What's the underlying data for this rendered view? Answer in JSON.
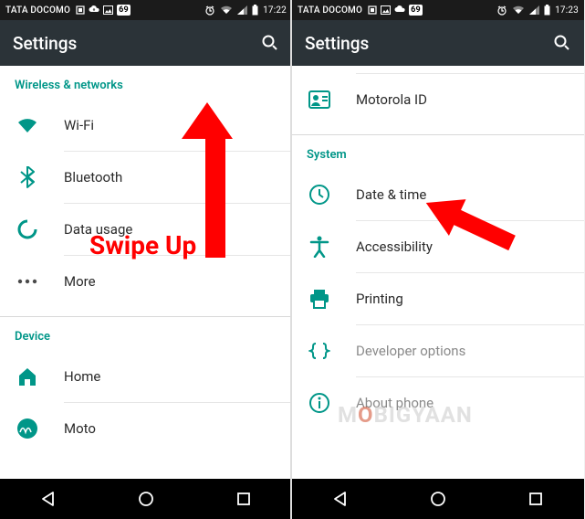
{
  "status": {
    "carrier": "TATA DOCOMO",
    "battery_badge": "69",
    "time_left": "17:22",
    "time_right": "17:23"
  },
  "appbar": {
    "title": "Settings"
  },
  "left": {
    "section1_header": "Wireless & networks",
    "items1": [
      {
        "label": "Wi-Fi"
      },
      {
        "label": "Bluetooth"
      },
      {
        "label": "Data usage"
      },
      {
        "label": "More"
      }
    ],
    "section2_header": "Device",
    "items2": [
      {
        "label": "Home"
      },
      {
        "label": "Moto"
      }
    ]
  },
  "right": {
    "top_item": {
      "label": "Motorola ID"
    },
    "section_header": "System",
    "items": [
      {
        "label": "Date & time"
      },
      {
        "label": "Accessibility"
      },
      {
        "label": "Printing"
      },
      {
        "label": "Developer options"
      },
      {
        "label": "About phone"
      }
    ]
  },
  "annotation": {
    "swipe_text": "Swipe Up",
    "watermark_a": "M",
    "watermark_o": "O",
    "watermark_b": "BIGYAAN"
  }
}
